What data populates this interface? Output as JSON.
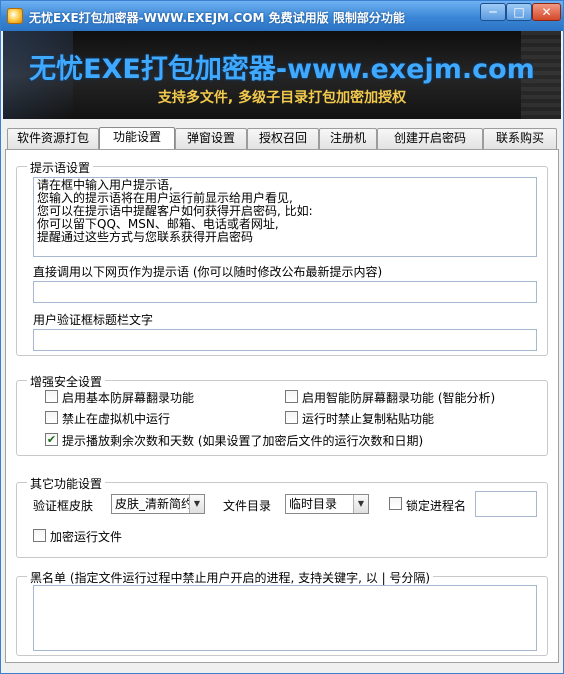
{
  "window": {
    "title": "无忧EXE打包加密器-WWW.EXEJM.COM  免费试用版  限制部分功能",
    "min_glyph": "─",
    "max_glyph": "□",
    "close_glyph": "✕"
  },
  "banner": {
    "title": "无忧EXE打包加密器-www.exejm.com",
    "subtitle": "支持多文件, 多级子目录打包加密加授权"
  },
  "tabs": [
    {
      "label": "软件资源打包"
    },
    {
      "label": "功能设置"
    },
    {
      "label": "弹窗设置"
    },
    {
      "label": "授权召回"
    },
    {
      "label": "注册机"
    },
    {
      "label": "创建开启密码"
    },
    {
      "label": "联系购买"
    }
  ],
  "prompt_group": {
    "legend": "提示语设置",
    "textarea_value": "请在框中输入用户提示语,\n您输入的提示语将在用户运行前显示给用户看见,\n您可以在提示语中提醒客户如何获得开启密码, 比如:\n你可以留下QQ、MSN、邮箱、电话或者网址,\n提醒通过这些方式与您联系获得开启密码",
    "url_label": "直接调用以下网页作为提示语 (你可以随时修改公布最新提示内容)",
    "url_value": "",
    "caption_label": "用户验证框标题栏文字",
    "caption_value": ""
  },
  "security_group": {
    "legend": "增强安全设置",
    "options": [
      {
        "label": "启用基本防屏幕翻录功能",
        "checked": false
      },
      {
        "label": "启用智能防屏幕翻录功能 (智能分析)",
        "checked": false
      },
      {
        "label": "禁止在虚拟机中运行",
        "checked": false
      },
      {
        "label": "运行时禁止复制粘贴功能",
        "checked": false
      },
      {
        "label": "提示播放剩余次数和天数 (如果设置了加密后文件的运行次数和日期)",
        "checked": true
      }
    ]
  },
  "other_group": {
    "legend": "其它功能设置",
    "skin_label": "验证框皮肤",
    "skin_value": "皮肤_清新简约",
    "dir_label": "文件目录",
    "dir_value": "临时目录",
    "lock_label": "锁定进程名",
    "lock_checked": false,
    "lock_value": "",
    "encrypt_run_label": "加密运行文件",
    "encrypt_run_checked": false
  },
  "blacklist_group": {
    "legend": "黑名单 (指定文件运行过程中禁止用户开启的进程, 支持关键字, 以 | 号分隔)",
    "value": ""
  },
  "colors": {
    "titlebar": "#3a86d6",
    "banner_bg": "#121212",
    "banner_title": "#3fa9ff",
    "banner_subtitle": "#f2c94c"
  }
}
